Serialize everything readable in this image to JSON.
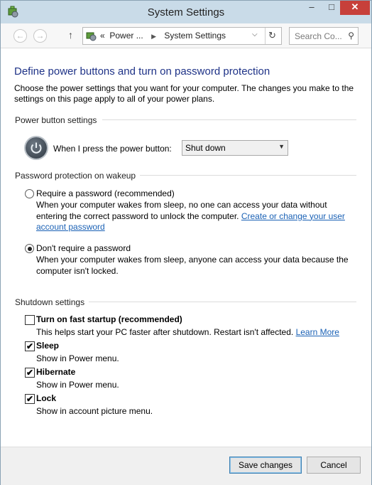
{
  "window": {
    "title": "System Settings",
    "minimize": "–",
    "maximize": "□",
    "close": "✕"
  },
  "nav": {
    "back": "←",
    "forward": "→",
    "up": "↑",
    "address_prefix": "«",
    "breadcrumb": [
      "Power ...",
      "System Settings"
    ],
    "dropdown": "⌵",
    "refresh": "↻",
    "search_placeholder": "Search Co...",
    "search_icon": "⚲"
  },
  "content": {
    "heading": "Define power buttons and turn on password protection",
    "description": "Choose the power settings that you want for your computer. The changes you make to the settings on this page apply to all of your power plans.",
    "power_button": {
      "section_title": "Power button settings",
      "label": "When I press the power button:",
      "selected": "Shut down"
    },
    "password": {
      "section_title": "Password protection on wakeup",
      "options": [
        {
          "label": "Require a password (recommended)",
          "description": "When your computer wakes from sleep, no one can access your data without entering the correct password to unlock the computer.",
          "link": "Create or change your user account password",
          "selected": false
        },
        {
          "label": "Don't require a password",
          "description": "When your computer wakes from sleep, anyone can access your data because the computer isn't locked.",
          "selected": true
        }
      ]
    },
    "shutdown": {
      "section_title": "Shutdown settings",
      "items": [
        {
          "label": "Turn on fast startup (recommended)",
          "description": "This helps start your PC faster after shutdown. Restart isn't affected.",
          "link": "Learn More",
          "checked": false
        },
        {
          "label": "Sleep",
          "description": "Show in Power menu.",
          "checked": true
        },
        {
          "label": "Hibernate",
          "description": "Show in Power menu.",
          "checked": true
        },
        {
          "label": "Lock",
          "description": "Show in account picture menu.",
          "checked": true
        }
      ]
    }
  },
  "footer": {
    "save": "Save changes",
    "cancel": "Cancel"
  },
  "colors": {
    "titlebar": "#c9dbe8",
    "heading": "#1e3287",
    "link": "#1a61b5",
    "close_button": "#c7403a"
  },
  "icons": {
    "app": "battery-settings-icon",
    "power": "power-icon",
    "check": "✔"
  }
}
